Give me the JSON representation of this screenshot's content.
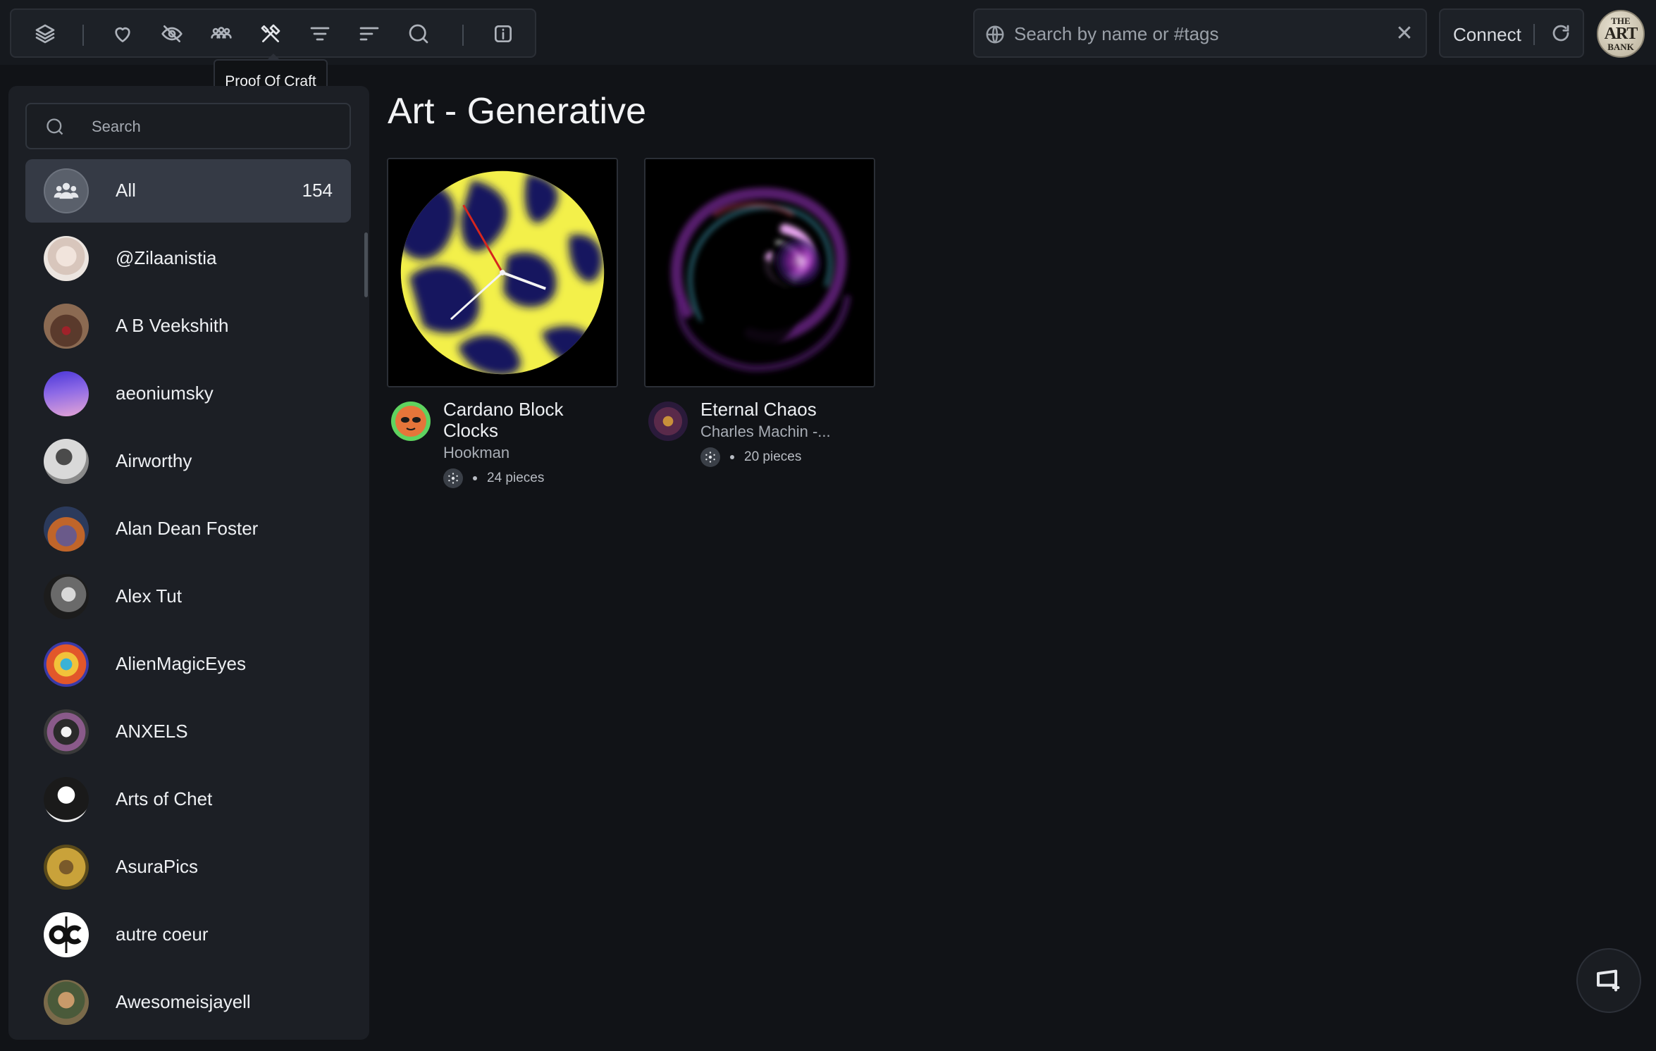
{
  "toolbar": {
    "icons": [
      "layers-icon",
      "heart-icon",
      "eye-off-icon",
      "people-icon",
      "craft-tools-icon",
      "filter-icon",
      "sort-icon",
      "search-icon",
      "info-icon"
    ],
    "tooltip": "Proof Of Craft"
  },
  "header": {
    "search_placeholder": "Search by name or #tags",
    "connect_label": "Connect",
    "logo_line1": "THE",
    "logo_line2": "ART",
    "logo_line3": "BANK"
  },
  "sidebar": {
    "search_placeholder": "Search",
    "all": {
      "label": "All",
      "count": "154"
    },
    "artists": [
      "@Zilaanistia",
      "A B Veekshith",
      "aeoniumsky",
      "Airworthy",
      "Alan Dean Foster",
      "Alex Tut",
      "AlienMagicEyes",
      "ANXELS",
      "Arts of Chet",
      "AsuraPics",
      "autre coeur",
      "Awesomeisjayell"
    ]
  },
  "main": {
    "title": "Art - Generative",
    "cards": [
      {
        "title": "Cardano Block Clocks",
        "author": "Hookman",
        "pieces": "24 pieces"
      },
      {
        "title": "Eternal Chaos",
        "author": "Charles Machin -...",
        "pieces": "20 pieces"
      }
    ]
  },
  "colors": {
    "background": "#111317",
    "panel": "#1c1f25",
    "active_item": "#353a45",
    "clock_yellow": "#f3f04a",
    "clock_navy": "#13175e"
  }
}
